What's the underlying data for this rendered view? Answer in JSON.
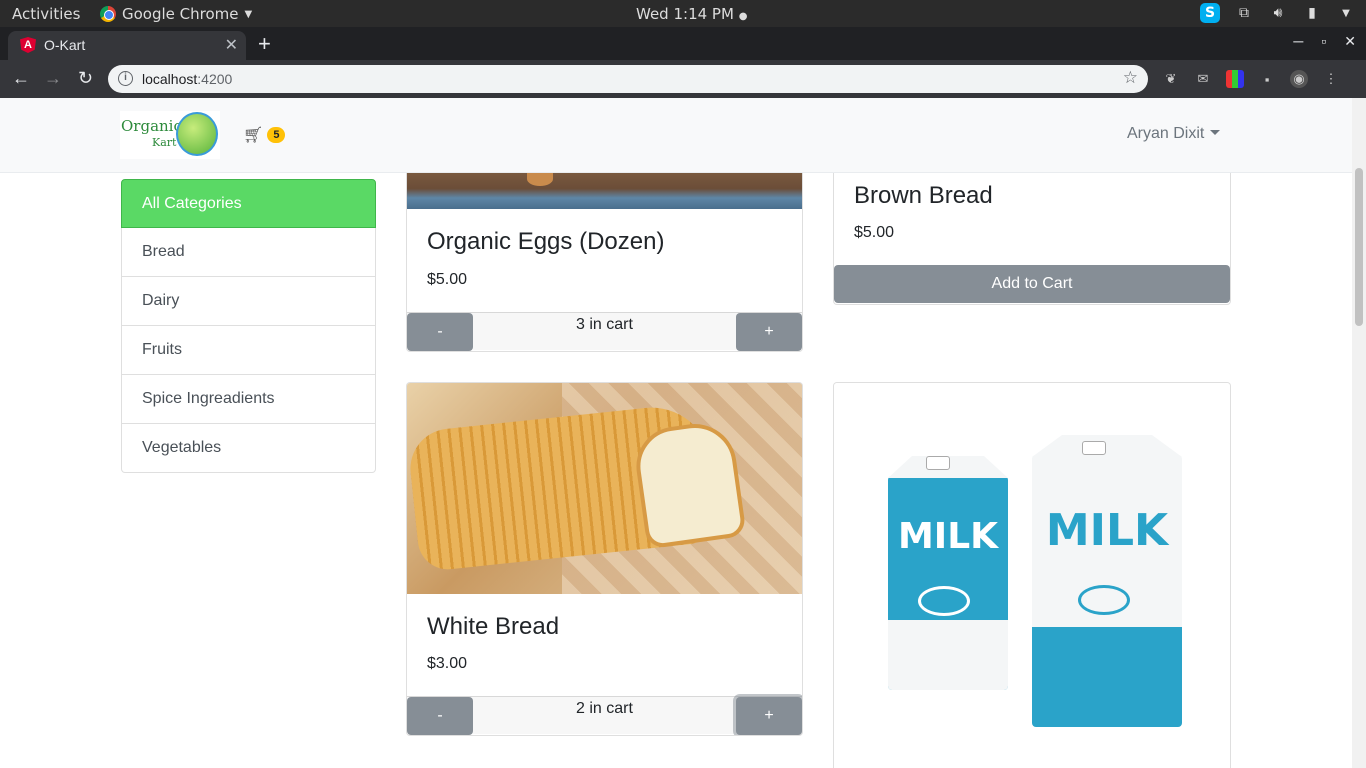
{
  "system_bar": {
    "activities": "Activities",
    "app_name": "Google Chrome",
    "clock": "Wed  1:14 PM"
  },
  "browser": {
    "tab_title": "O-Kart",
    "url_host": "localhost",
    "url_port": ":4200"
  },
  "navbar": {
    "logo_word1": "Organic",
    "logo_word2": "Kart",
    "cart_count": "5",
    "user_name": "Aryan Dixit"
  },
  "categories": [
    {
      "label": "All Categories",
      "active": true
    },
    {
      "label": "Bread"
    },
    {
      "label": "Dairy"
    },
    {
      "label": "Fruits"
    },
    {
      "label": "Spice Ingreadients"
    },
    {
      "label": "Vegetables"
    }
  ],
  "products": {
    "eggs": {
      "title": "Organic Eggs (Dozen)",
      "price": "$5.00",
      "minus": "-",
      "qty_text": "3 in cart",
      "plus": "+"
    },
    "brown_bread": {
      "title": "Brown Bread",
      "price": "$5.00",
      "add_label": "Add to Cart"
    },
    "white_bread": {
      "title": "White Bread",
      "price": "$3.00",
      "minus": "-",
      "qty_text": "2 in cart",
      "plus": "+"
    },
    "milk": {
      "carton_label": "MILK"
    }
  },
  "colors": {
    "active_category": "#5ad965",
    "button_secondary": "#868e96",
    "badge": "#ffc107"
  }
}
